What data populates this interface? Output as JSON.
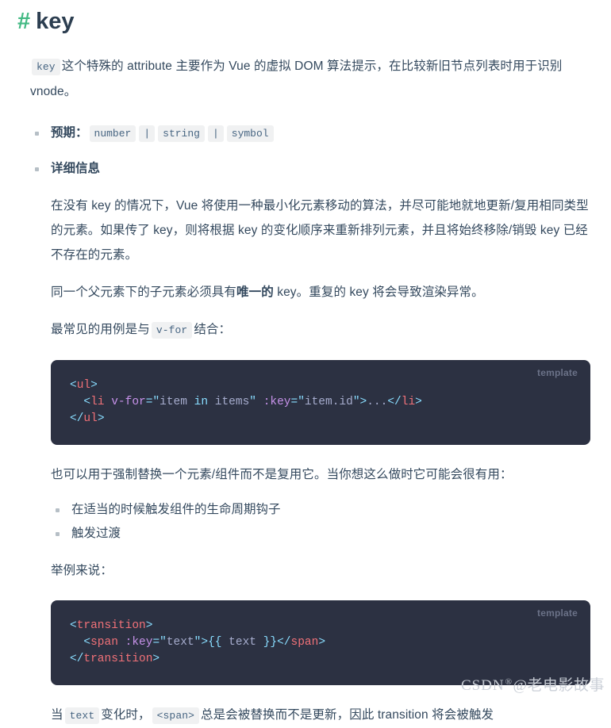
{
  "heading": {
    "hash": "#",
    "title": "key"
  },
  "intro": {
    "code": "key",
    "text_a": "这个特殊的 attribute 主要作为 Vue 的虚拟 DOM 算法提示，在比较新旧节点列表时用于识别 vnode。"
  },
  "top_bullets": [
    {
      "label": "预期",
      "colon": "：",
      "codes": [
        "number",
        "|",
        "string",
        "|",
        "symbol"
      ]
    },
    {
      "label": "详细信息"
    }
  ],
  "details": {
    "paragraph_1": "在没有 key 的情况下，Vue 将使用一种最小化元素移动的算法，并尽可能地就地更新/复用相同类型的元素。如果传了 key，则将根据 key 的变化顺序来重新排列元素，并且将始终移除/销毁 key 已经不存在的元素。",
    "paragraph_2_pre": "同一个父元素下的子元素必须具有",
    "paragraph_2_strong": "唯一的",
    "paragraph_2_post": " key。重复的 key 将会导致渲染异常。",
    "paragraph_3_pre": "最常见的用例是与",
    "paragraph_3_code": "v-for",
    "paragraph_3_post": "结合：",
    "paragraph_4": "也可以用于强制替换一个元素/组件而不是复用它。当你想这么做时它可能会很有用：",
    "inner_bullets": [
      "在适当的时候触发组件的生命周期钩子",
      "触发过渡"
    ],
    "paragraph_5": "举例来说：",
    "paragraph_6_pre": "当",
    "paragraph_6_code_1": "text",
    "paragraph_6_mid": "变化时，",
    "paragraph_6_code_2": "<span>",
    "paragraph_6_post": "总是会被替换而不是更新，因此 transition 将会被触发"
  },
  "code_blocks": [
    {
      "lang_label": "template",
      "lines": [
        [
          {
            "t": "<",
            "c": "punct"
          },
          {
            "t": "ul",
            "c": "tag"
          },
          {
            "t": ">",
            "c": "punct"
          }
        ],
        [
          {
            "t": "  ",
            "c": "plain"
          },
          {
            "t": "<",
            "c": "punct"
          },
          {
            "t": "li",
            "c": "tag"
          },
          {
            "t": " ",
            "c": "plain"
          },
          {
            "t": "v-for",
            "c": "attr"
          },
          {
            "t": "=",
            "c": "punct"
          },
          {
            "t": "\"",
            "c": "punct"
          },
          {
            "t": "item ",
            "c": "str"
          },
          {
            "t": "in",
            "c": "kw"
          },
          {
            "t": " items",
            "c": "str"
          },
          {
            "t": "\"",
            "c": "punct"
          },
          {
            "t": " ",
            "c": "plain"
          },
          {
            "t": ":key",
            "c": "attr"
          },
          {
            "t": "=",
            "c": "punct"
          },
          {
            "t": "\"",
            "c": "punct"
          },
          {
            "t": "item.id",
            "c": "str"
          },
          {
            "t": "\"",
            "c": "punct"
          },
          {
            "t": ">",
            "c": "punct"
          },
          {
            "t": "...",
            "c": "plain"
          },
          {
            "t": "</",
            "c": "punct"
          },
          {
            "t": "li",
            "c": "tag"
          },
          {
            "t": ">",
            "c": "punct"
          }
        ],
        [
          {
            "t": "</",
            "c": "punct"
          },
          {
            "t": "ul",
            "c": "tag"
          },
          {
            "t": ">",
            "c": "punct"
          }
        ]
      ]
    },
    {
      "lang_label": "template",
      "lines": [
        [
          {
            "t": "<",
            "c": "punct"
          },
          {
            "t": "transition",
            "c": "tag"
          },
          {
            "t": ">",
            "c": "punct"
          }
        ],
        [
          {
            "t": "  ",
            "c": "plain"
          },
          {
            "t": "<",
            "c": "punct"
          },
          {
            "t": "span",
            "c": "tag"
          },
          {
            "t": " ",
            "c": "plain"
          },
          {
            "t": ":key",
            "c": "attr"
          },
          {
            "t": "=",
            "c": "punct"
          },
          {
            "t": "\"",
            "c": "punct"
          },
          {
            "t": "text",
            "c": "str"
          },
          {
            "t": "\"",
            "c": "punct"
          },
          {
            "t": ">",
            "c": "punct"
          },
          {
            "t": "{{",
            "c": "kw"
          },
          {
            "t": " text ",
            "c": "str"
          },
          {
            "t": "}}",
            "c": "kw"
          },
          {
            "t": "</",
            "c": "punct"
          },
          {
            "t": "span",
            "c": "tag"
          },
          {
            "t": ">",
            "c": "punct"
          }
        ],
        [
          {
            "t": "</",
            "c": "punct"
          },
          {
            "t": "transition",
            "c": "tag"
          },
          {
            "t": ">",
            "c": "punct"
          }
        ]
      ]
    }
  ],
  "watermark": {
    "brand": "CSDN",
    "registered": "®",
    "author": "@老电影故事"
  },
  "colors": {
    "accent_green": "#42b983",
    "heading": "#2c3e50",
    "body_text": "#34495e",
    "inline_code_bg": "#f0f1f2",
    "inline_code_text": "#476582",
    "code_block_bg": "#2c3142",
    "code_punct": "#89ddff",
    "code_tag": "#f07178",
    "code_attr": "#c792ea",
    "code_text": "#a6accd",
    "lang_tag": "#6b7288",
    "bullet": "#b6bfc6",
    "watermark": "#c9ced6"
  }
}
